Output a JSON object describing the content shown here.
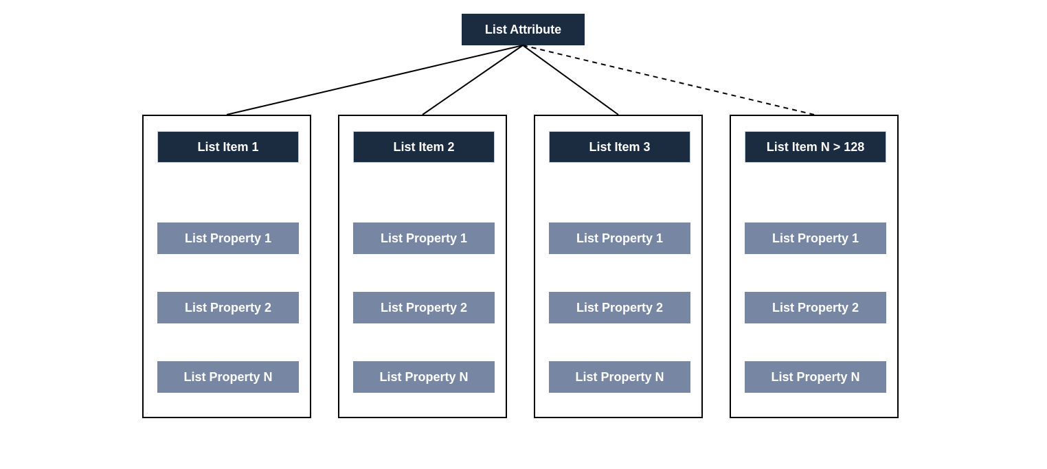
{
  "root": {
    "label": "List Attribute"
  },
  "columns": [
    {
      "header": "List Item 1",
      "dashed": false,
      "properties": [
        "List Property 1",
        "List Property 2",
        "List Property N"
      ]
    },
    {
      "header": "List Item 2",
      "dashed": false,
      "properties": [
        "List Property 1",
        "List Property 2",
        "List Property N"
      ]
    },
    {
      "header": "List Item 3",
      "dashed": false,
      "properties": [
        "List Property 1",
        "List Property 2",
        "List Property N"
      ]
    },
    {
      "header": "List Item N > 128",
      "dashed": true,
      "properties": [
        "List Property 1",
        "List Property 2",
        "List Property N"
      ]
    }
  ]
}
